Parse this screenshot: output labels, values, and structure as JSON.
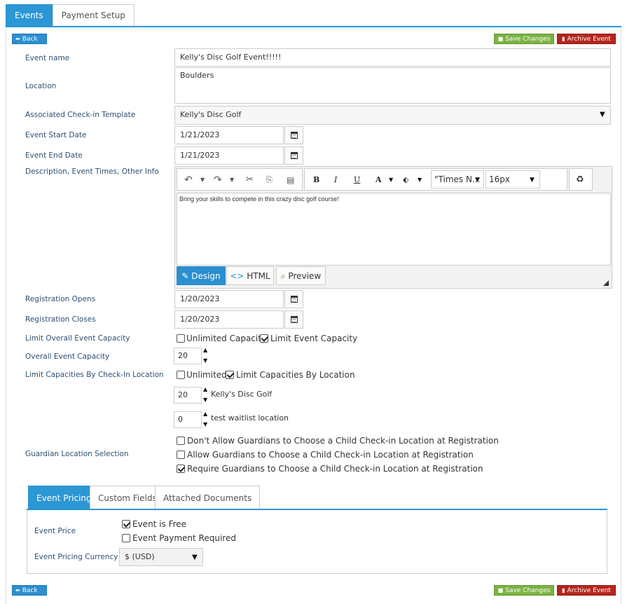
{
  "tabs": {
    "events": "Events",
    "payment_setup": "Payment Setup"
  },
  "buttons": {
    "back": "Back",
    "save": "Save Changes",
    "archive": "Archive Event"
  },
  "fields": {
    "event_name": {
      "label": "Event name",
      "value": "Kelly's Disc Golf Event!!!!!"
    },
    "location": {
      "label": "Location",
      "value": "Boulders"
    },
    "template": {
      "label": "Associated Check-in Template",
      "value": "Kelly's Disc Golf"
    },
    "start_date": {
      "label": "Event Start Date",
      "value": "1/21/2023"
    },
    "end_date": {
      "label": "Event End Date",
      "value": "1/21/2023"
    },
    "description": {
      "label": "Description, Event Times, Other Info"
    },
    "reg_opens": {
      "label": "Registration Opens",
      "value": "1/20/2023"
    },
    "reg_closes": {
      "label": "Registration Closes",
      "value": "1/20/2023"
    },
    "limit_capacity": {
      "label": "Limit Overall Event Capacity",
      "opt_unlimited": "Unlimited Capacity",
      "opt_limit": "Limit Event Capacity"
    },
    "overall_capacity": {
      "label": "Overall Event Capacity",
      "value": "20"
    },
    "limit_by_location": {
      "label": "Limit Capacities By Check-In Location",
      "opt_unlimited": "Unlimited",
      "opt_limit": "Limit Capacities By Location"
    },
    "locations": [
      {
        "value": "20",
        "name": "Kelly's Disc Golf"
      },
      {
        "value": "0",
        "name": "test waitlist location"
      }
    ],
    "guardian": {
      "label": "Guardian Location Selection",
      "opt1": "Don't Allow Guardians to Choose a Child Check-in Location at Registration",
      "opt2": "Allow Guardians to Choose a Child Check-in Location at Registration",
      "opt3": "Require Guardians to Choose a Child Check-in Location at Registration"
    }
  },
  "editor": {
    "font": "\"Times N...",
    "size": "16px",
    "content": "Bring your skills to compete in this crazy disc golf course!",
    "mode_design": "Design",
    "mode_html": "HTML",
    "mode_preview": "Preview"
  },
  "pricing": {
    "tabs": {
      "pricing": "Event Pricing",
      "custom": "Custom Fields",
      "docs": "Attached Documents"
    },
    "price_label": "Event Price",
    "opt_free": "Event is Free",
    "opt_paid": "Event Payment Required",
    "currency_label": "Event Pricing Currency",
    "currency_value": "$ (USD)"
  },
  "colors": {
    "accent": "#2b97d4",
    "save": "#7bb342",
    "archive": "#b5261c"
  }
}
